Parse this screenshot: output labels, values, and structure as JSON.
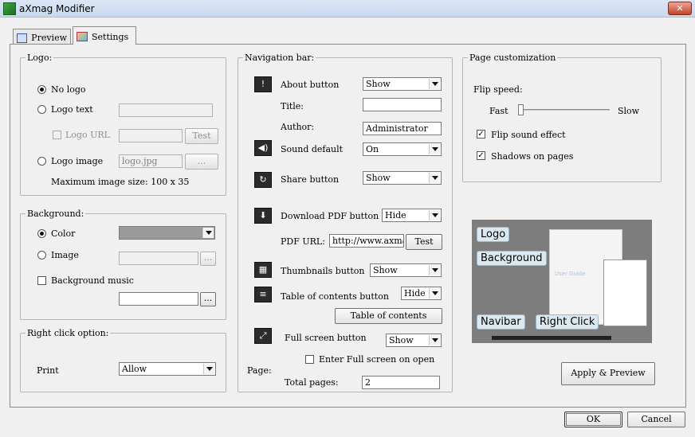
{
  "window": {
    "title": "aXmag Modifier",
    "close_glyph": "✕"
  },
  "tabs": [
    {
      "label": "Preview"
    },
    {
      "label": "Settings"
    }
  ],
  "logo": {
    "legend": "Logo:",
    "no_logo": "No logo",
    "logo_text": "Logo text",
    "logo_url": "Logo URL",
    "test": "Test",
    "logo_image": "Logo image",
    "logo_image_value": "logo.jpg",
    "browse": "...",
    "max_size": "Maximum image size: 100 x 35"
  },
  "background": {
    "legend": "Background:",
    "color": "Color",
    "image": "Image",
    "browse": "...",
    "music": "Background music",
    "music_browse": "..."
  },
  "right_click": {
    "legend": "Right click option:",
    "print_label": "Print",
    "print_value": "Allow"
  },
  "navbar": {
    "legend": "Navigation bar:",
    "about_label": "About button",
    "about_value": "Show",
    "title_label": "Title:",
    "title_value": "",
    "author_label": "Author:",
    "author_value": "Administrator",
    "sound_label": "Sound default",
    "sound_value": "On",
    "share_label": "Share button",
    "share_value": "Show",
    "download_label": "Download PDF button",
    "download_value": "Hide",
    "pdf_url_label": "PDF URL:",
    "pdf_url_value": "http://www.axma",
    "pdf_test": "Test",
    "thumbs_label": "Thumbnails button",
    "thumbs_value": "Show",
    "toc_label": "Table of contents button",
    "toc_value": "Hide",
    "toc_button": "Table of contents",
    "fullscreen_label": "Full screen button",
    "fullscreen_value": "Show",
    "fullscreen_open": "Enter Full screen on open",
    "page_label": "Page:",
    "total_pages_label": "Total pages:",
    "total_pages_value": "2"
  },
  "page_custom": {
    "legend": "Page customization",
    "flip_speed": "Flip speed:",
    "fast": "Fast",
    "slow": "Slow",
    "flip_speed_level": 0.0,
    "flip_sound": "Flip sound effect",
    "shadows": "Shadows on pages",
    "check_glyph": "✓"
  },
  "preview": {
    "callouts": {
      "logo": "Logo",
      "background": "Background",
      "navibar": "Navibar",
      "right_click": "Right Click"
    },
    "user_guide": "User Guide"
  },
  "buttons": {
    "apply_preview": "Apply & Preview",
    "ok": "OK",
    "cancel": "Cancel"
  },
  "icons": {
    "about": "!",
    "sound": "◀)",
    "share": "↻",
    "download": "⬇",
    "thumbnails": "▦",
    "toc": "≡",
    "fullscreen": "⤢"
  },
  "colors": {
    "preview_bg": "#7d7d7d",
    "callout_bg": "#dce8f0",
    "close_red": "#c3452c"
  }
}
